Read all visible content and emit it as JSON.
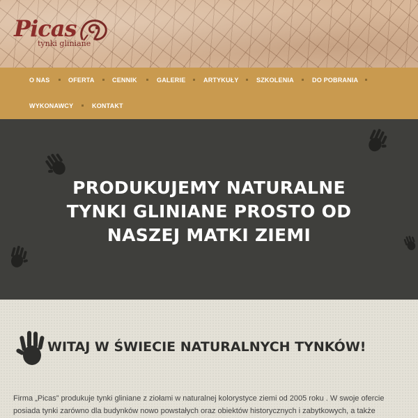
{
  "header": {
    "logo_text": "Picas",
    "logo_tagline": "tynki gliniane"
  },
  "nav": {
    "items": [
      {
        "label": "O NAS"
      },
      {
        "label": "OFERTA"
      },
      {
        "label": "CENNIK"
      },
      {
        "label": "GALERIE"
      },
      {
        "label": "ARTYKUŁY"
      },
      {
        "label": "SZKOLENIA"
      },
      {
        "label": "DO POBRANIA"
      },
      {
        "label": "WYKONAWCY"
      },
      {
        "label": "KONTAKT"
      }
    ],
    "background": "#c99a4f"
  },
  "hero": {
    "title": "PRODUKUJEMY NATURALNE TYNKI GLINIANE PROSTO OD NASZEJ MATKI ZIEMI",
    "background": "#3f3f3c",
    "icons": [
      "handprint-icon",
      "handprint-icon",
      "handprint-icon",
      "handprint-icon"
    ]
  },
  "content": {
    "welcome_title": "WITAJ W ŚWIECIE NATURALNYCH TYNKÓW!",
    "intro_line1": "Firma „Picas” produkuje tynki gliniane z ziołami w naturalnej kolorystyce ziemi od 2005 roku . W swoje ofercie",
    "intro_line2": "posiada tynki zarówno dla budynków nowo powstałych oraz obiektów historycznych i zabytkowych, a także"
  },
  "colors": {
    "accent": "#c99a4f",
    "brand": "#8b2d2a",
    "hero_bg": "#3f3f3c"
  }
}
